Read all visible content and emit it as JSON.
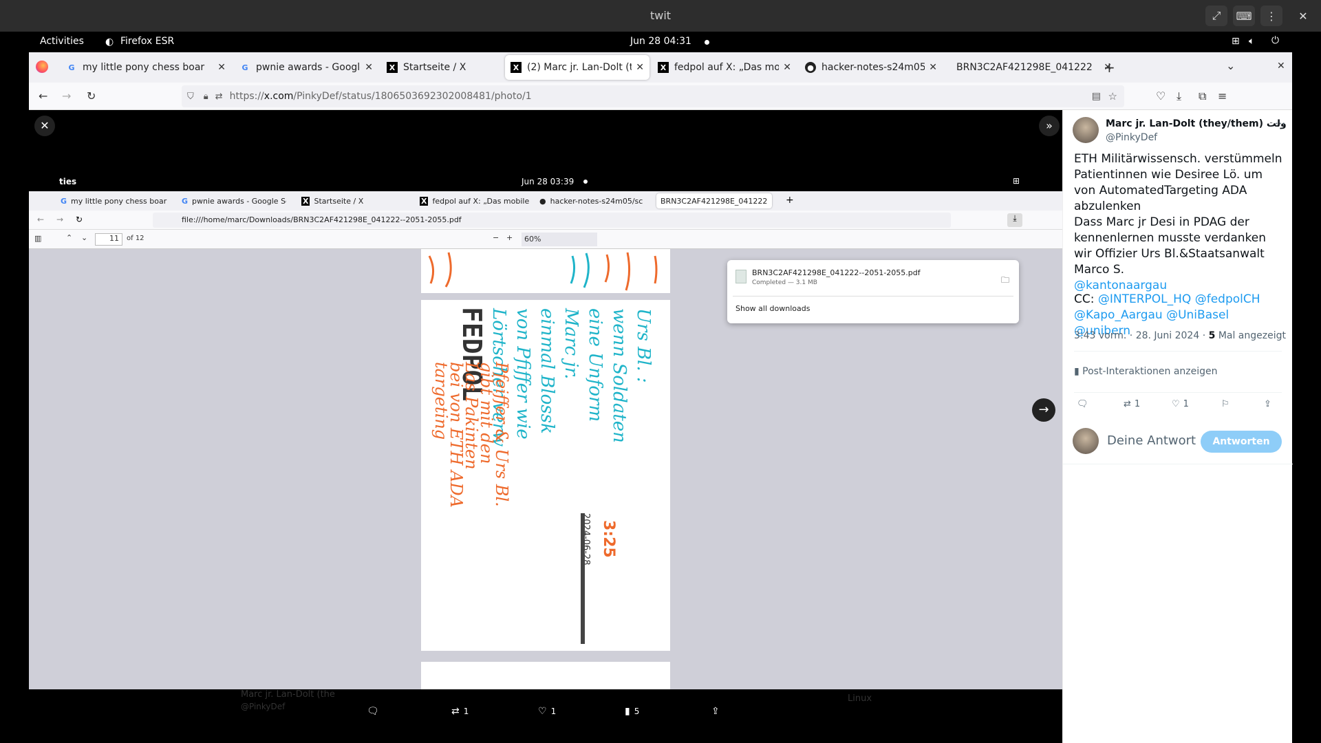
{
  "outer_window": {
    "title": "twit"
  },
  "gnome": {
    "activities": "Activities",
    "app": "Firefox ESR",
    "clock": "Jun 28  04:31"
  },
  "tabs": [
    {
      "label": "my little pony chess boar",
      "icon": "google"
    },
    {
      "label": "pwnie awards - Google Sc",
      "icon": "google"
    },
    {
      "label": "Startseite / X",
      "icon": "x"
    },
    {
      "label": "(2) Marc jr. Lan-Dolt (they",
      "icon": "x"
    },
    {
      "label": "fedpol auf X: „Das mobile",
      "icon": "x"
    },
    {
      "label": "hacker-notes-s24m05/sc",
      "icon": "github"
    },
    {
      "label": "BRN3C2AF421298E_041222",
      "icon": "none"
    }
  ],
  "address": {
    "prefix": "https://",
    "host": "x.com",
    "path": "/PinkyDef/status/1806503692302008481/photo/1"
  },
  "inner": {
    "activities": "ties",
    "clock": "Jun 28  03:39",
    "tabs": [
      "my little pony chess boar",
      "pwnie awards - Google Sc",
      "Startseite / X",
      "fedpol auf X: „Das mobile",
      "hacker-notes-s24m05/sc",
      "BRN3C2AF421298E_041222"
    ],
    "url": "file:///home/marc/Downloads/BRN3C2AF421298E_041222--2051-2055.pdf",
    "page_number": "11",
    "page_count": "of 12",
    "zoom": "60%",
    "download": {
      "filename": "BRN3C2AF421298E_041222--2051-2055.pdf",
      "status": "Completed — 3.1 MB",
      "show_all": "Show all downloads"
    },
    "handwriting": {
      "fedpol": "FEDPOL",
      "time": "3:25",
      "date": "2024-06-28",
      "blue_lines": [
        "Urs Bl. :",
        "wenn Soldaten",
        "eine Unform",
        "Marc jr.",
        "einmal Blossk",
        "von Pfiffer wie",
        "Lörtscher verw"
      ],
      "orange_lines": [
        "Pfeiffer & Urs Bl.",
        "gibt mit den",
        "Las Pakinten",
        "bei von ETH ADA",
        "targeting"
      ]
    },
    "bottom_bar": {
      "name": "Marc jr. Lan-Dolt (the",
      "handle": "@PinkyDef",
      "side": "Linux",
      "retweets": "1",
      "likes": "1",
      "views": "5"
    }
  },
  "tweet": {
    "name": "Marc jr. Lan-Dolt (they/them) ولت",
    "handle": "@PinkyDef",
    "p1": "ETH Militärwissensch. verstümmeln Patientinnen wie Desiree Lö. um von AutomatedTargeting ADA abzulenken",
    "p2": "Dass Marc jr Desi in PDAG der kennenlernen musste verdanken wir Offizier Urs Bl.&Staatsanwalt Marco S.",
    "p2_link": "@kantonaargau",
    "cc_prefix": "CC:",
    "cc_links": [
      "@INTERPOL_HQ",
      "@fedpolCH",
      "@Kapo_Aargau",
      "@UniBasel",
      "@unibern"
    ],
    "meta_time": "3:43 vorm. · 28. Juni 2024 ·",
    "meta_views_num": "5",
    "meta_views_label": "Mal angezeigt",
    "interactions": "Post-Interaktionen anzeigen",
    "retweets": "1",
    "likes": "1",
    "reply_placeholder": "Deine Antwort",
    "reply_button": "Antworten"
  },
  "colors": {
    "accent": "#1d9bf0",
    "ink_blue": "#1fb4c9",
    "ink_orange": "#ee6a2c"
  }
}
